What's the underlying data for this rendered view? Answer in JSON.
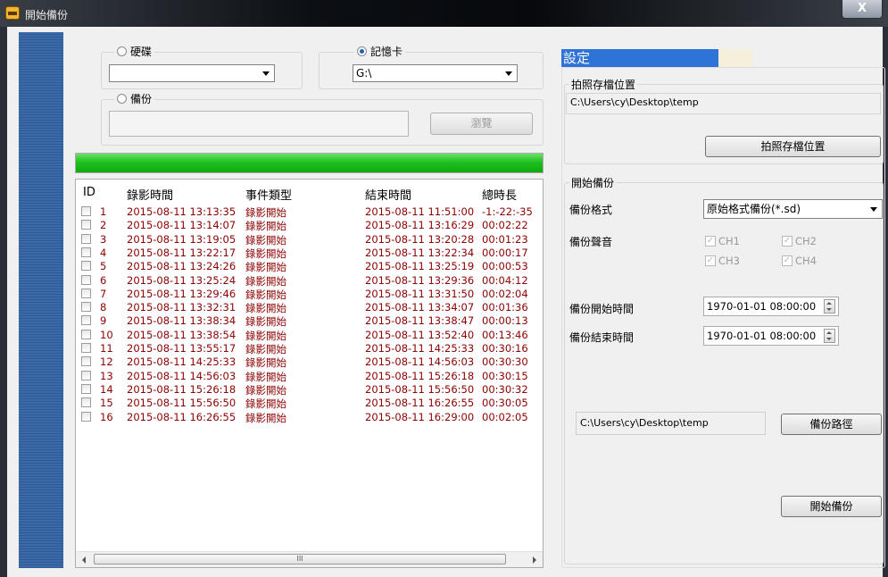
{
  "window": {
    "title": "開始備份",
    "close_label": "X"
  },
  "source": {
    "hdd_label": "硬碟",
    "hdd_selected": false,
    "hdd_value": "",
    "card_label": "記憶卡",
    "card_selected": true,
    "card_value": "G:\\",
    "backup_label": "備份",
    "backup_selected": false,
    "backup_path": "",
    "browse_label": "瀏覽"
  },
  "progress": {
    "percent": 100
  },
  "table": {
    "columns": [
      "ID",
      "錄影時間",
      "事件類型",
      "結束時間",
      "總時長"
    ],
    "rows": [
      {
        "id": "1",
        "start": "2015-08-11 13:13:35",
        "type": "錄影開始",
        "end": "2015-08-11 11:51:00",
        "dur": "-1:-22:-35"
      },
      {
        "id": "2",
        "start": "2015-08-11 13:14:07",
        "type": "錄影開始",
        "end": "2015-08-11 13:16:29",
        "dur": "00:02:22"
      },
      {
        "id": "3",
        "start": "2015-08-11 13:19:05",
        "type": "錄影開始",
        "end": "2015-08-11 13:20:28",
        "dur": "00:01:23"
      },
      {
        "id": "4",
        "start": "2015-08-11 13:22:17",
        "type": "錄影開始",
        "end": "2015-08-11 13:22:34",
        "dur": "00:00:17"
      },
      {
        "id": "5",
        "start": "2015-08-11 13:24:26",
        "type": "錄影開始",
        "end": "2015-08-11 13:25:19",
        "dur": "00:00:53"
      },
      {
        "id": "6",
        "start": "2015-08-11 13:25:24",
        "type": "錄影開始",
        "end": "2015-08-11 13:29:36",
        "dur": "00:04:12"
      },
      {
        "id": "7",
        "start": "2015-08-11 13:29:46",
        "type": "錄影開始",
        "end": "2015-08-11 13:31:50",
        "dur": "00:02:04"
      },
      {
        "id": "8",
        "start": "2015-08-11 13:32:31",
        "type": "錄影開始",
        "end": "2015-08-11 13:34:07",
        "dur": "00:01:36"
      },
      {
        "id": "9",
        "start": "2015-08-11 13:38:34",
        "type": "錄影開始",
        "end": "2015-08-11 13:38:47",
        "dur": "00:00:13"
      },
      {
        "id": "10",
        "start": "2015-08-11 13:38:54",
        "type": "錄影開始",
        "end": "2015-08-11 13:52:40",
        "dur": "00:13:46"
      },
      {
        "id": "11",
        "start": "2015-08-11 13:55:17",
        "type": "錄影開始",
        "end": "2015-08-11 14:25:33",
        "dur": "00:30:16"
      },
      {
        "id": "12",
        "start": "2015-08-11 14:25:33",
        "type": "錄影開始",
        "end": "2015-08-11 14:56:03",
        "dur": "00:30:30"
      },
      {
        "id": "13",
        "start": "2015-08-11 14:56:03",
        "type": "錄影開始",
        "end": "2015-08-11 15:26:18",
        "dur": "00:30:15"
      },
      {
        "id": "14",
        "start": "2015-08-11 15:26:18",
        "type": "錄影開始",
        "end": "2015-08-11 15:56:50",
        "dur": "00:30:32"
      },
      {
        "id": "15",
        "start": "2015-08-11 15:56:50",
        "type": "錄影開始",
        "end": "2015-08-11 16:26:55",
        "dur": "00:30:05"
      },
      {
        "id": "16",
        "start": "2015-08-11 16:26:55",
        "type": "錄影開始",
        "end": "2015-08-11 16:29:00",
        "dur": "00:02:05"
      }
    ],
    "scroll_thumb_label": "III"
  },
  "settings": {
    "title": "設定",
    "snapshot_group_label": "拍照存檔位置",
    "snapshot_path": "C:\\Users\\cy\\Desktop\\temp",
    "snapshot_button": "拍照存檔位置",
    "backup_group_label": "開始備份",
    "format_label": "備份格式",
    "format_value": "原始格式備份(*.sd)",
    "audio_label": "備份聲音",
    "channels": [
      "CH1",
      "CH2",
      "CH3",
      "CH4"
    ],
    "start_time_label": "備份開始時間",
    "start_time_value": "1970-01-01 08:00:00",
    "end_time_label": "備份結束時間",
    "end_time_value": "1970-01-01 08:00:00",
    "backup_path": "C:\\Users\\cy\\Desktop\\temp",
    "backup_path_button": "備份路徑",
    "start_backup_button": "開始備份"
  }
}
